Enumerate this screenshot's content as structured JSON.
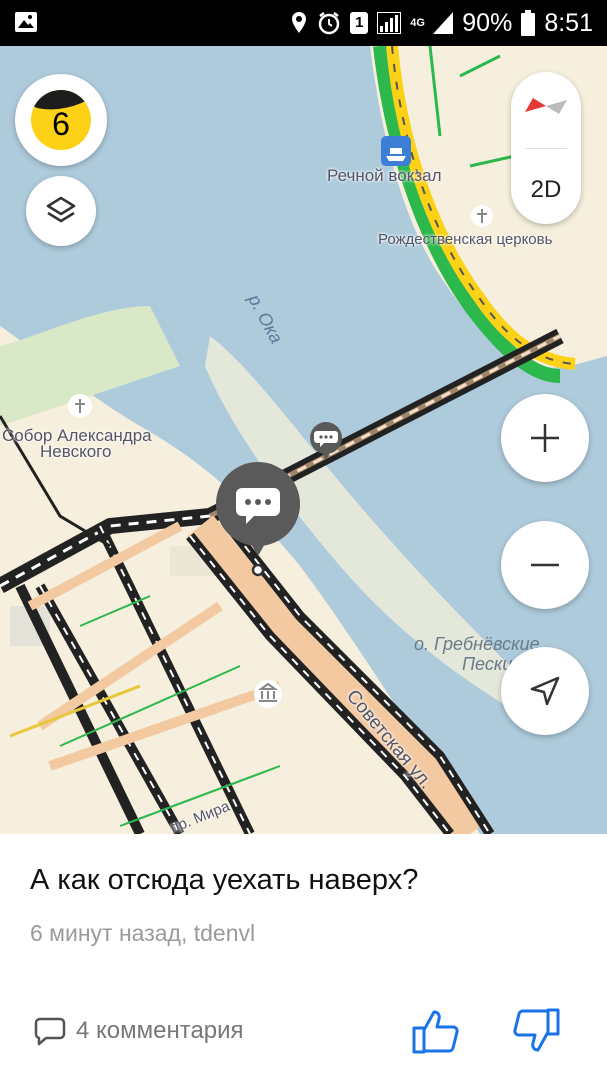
{
  "status_bar": {
    "sim_slot": "1",
    "network": "4G",
    "battery": "90%",
    "time": "8:51"
  },
  "map": {
    "traffic_level": "6",
    "view_mode": "2D",
    "labels": {
      "river_station": "Речной вокзал",
      "church": "Рождественская церковь",
      "river": "р. Ока",
      "cathedral_line1": "Собор Александра",
      "cathedral_line2": "Невского",
      "island_line1": "о. Гребнёвские",
      "island_line2": "Пески",
      "street_sovetskaya": "Советская ул.",
      "street_mira": "пр. Мира"
    }
  },
  "post": {
    "title": "А как отсюда уехать наверх?",
    "meta": "6 минут назад, tdenvl",
    "comments": "4 комментария"
  },
  "colors": {
    "water": "#aecbdc",
    "land": "#f6efdd",
    "accent_blue": "#1a73e8",
    "traffic_yellow": "#fcd116"
  }
}
